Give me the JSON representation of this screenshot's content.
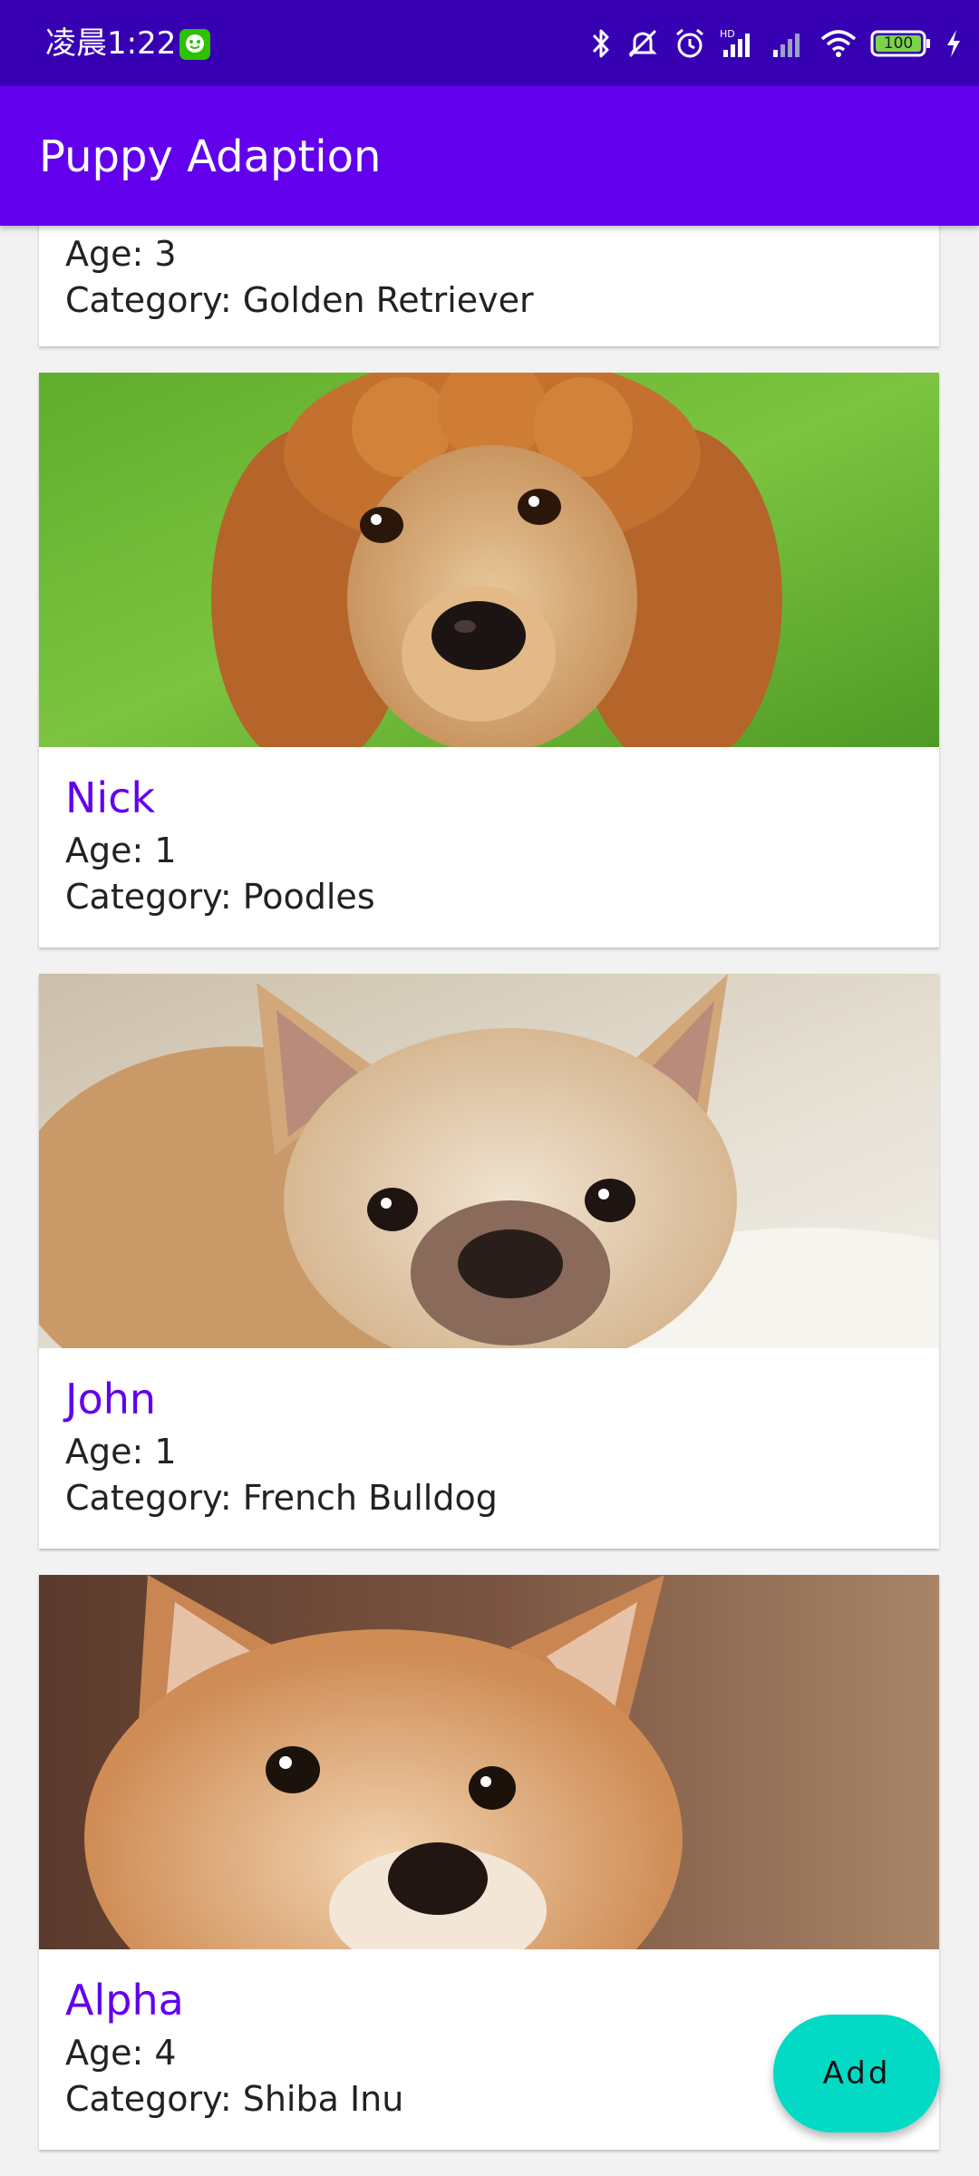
{
  "status_bar": {
    "time": "凌晨1:22",
    "battery": "100"
  },
  "app_bar": {
    "title": "Puppy Adaption"
  },
  "puppies": [
    {
      "name": "",
      "age": "Age: 3",
      "category": "Category: Golden Retriever"
    },
    {
      "name": "Nick",
      "age": "Age: 1",
      "category": "Category: Poodles",
      "photo": "poodle-photo"
    },
    {
      "name": "John",
      "age": "Age: 1",
      "category": "Category: French Bulldog",
      "photo": "french-bulldog-photo"
    },
    {
      "name": "Alpha",
      "age": "Age: 4",
      "category": "Category: Shiba Inu",
      "photo": "shiba-inu-photo"
    }
  ],
  "fab": {
    "label": "Add"
  },
  "colors": {
    "status_bar": "#3700b3",
    "app_bar": "#6200ee",
    "accent_name": "#6200ee",
    "fab": "#03dac5"
  }
}
